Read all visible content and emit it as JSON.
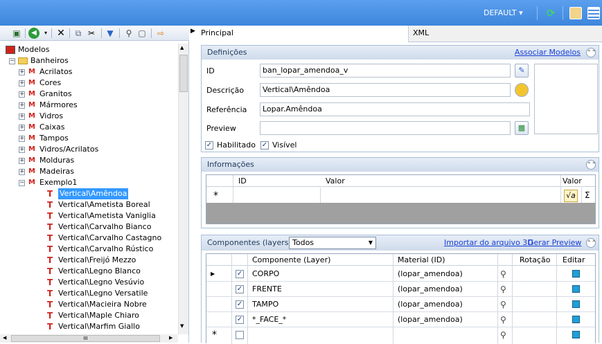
{
  "topbar": {
    "profile_dropdown": "DEFAULT",
    "icons": [
      "refresh-icon",
      "settings-icon",
      "layout-icon"
    ]
  },
  "left_toolbar": {
    "icons": [
      "save-icon",
      "back-icon",
      "delete-icon",
      "copy-icon",
      "cut-icon",
      "move-icon",
      "find-icon",
      "page-icon",
      "export-icon"
    ]
  },
  "tree": {
    "root": "Modelos",
    "category": "Banheiros",
    "groups": [
      "Acrilatos",
      "Cores",
      "Granitos",
      "Mármores",
      "Vidros",
      "Caixas",
      "Tampos",
      "Vidros/Acrilatos",
      "Molduras",
      "Madeiras",
      "Exemplo1"
    ],
    "children": [
      "Vertical\\Amêndoa",
      "Vertical\\Ametista Boreal",
      "Vertical\\Ametista Vaniglia",
      "Vertical\\Carvalho Bianco",
      "Vertical\\Carvalho Castagno",
      "Vertical\\Carvalho Rústico",
      "Vertical\\Freijó Mezzo",
      "Vertical\\Legno Blanco",
      "Vertical\\Legno Vesúvio",
      "Vertical\\Legno Versatile",
      "Vertical\\Macieira Nobre",
      "Vertical\\Maple Chiaro",
      "Vertical\\Marfim Giallo"
    ],
    "hscroll_label": "III"
  },
  "tabs": [
    "Principal",
    "XML"
  ],
  "definicoes": {
    "title": "Definições",
    "link": "Associar Modelos",
    "labels": {
      "id": "ID",
      "descricao": "Descrição",
      "referencia": "Referência",
      "preview": "Preview"
    },
    "values": {
      "id": "ban_lopar_amendoa_v",
      "descricao": "Vertical\\Amêndoa",
      "referencia": "Lopar.Amêndoa",
      "preview": ""
    },
    "habilitado": "Habilitado",
    "visivel": "Visível"
  },
  "informacoes": {
    "title": "Informações",
    "columns": [
      "ID",
      "Valor",
      "Valor"
    ],
    "new_row_marker": "*",
    "sqrt_symbol": "√a",
    "sigma_symbol": "Σ"
  },
  "componentes": {
    "title": "Componentes (layers)",
    "filter": "Todos",
    "link_import": "Importar do arquivo 3D",
    "link_preview": "Gerar Preview",
    "columns": [
      "Componente (Layer)",
      "Material (ID)",
      "Rotação",
      "Editar"
    ],
    "rows": [
      {
        "name": "CORPO",
        "material": "(lopar_amendoa)"
      },
      {
        "name": "FRENTE",
        "material": "(lopar_amendoa)"
      },
      {
        "name": "TAMPO",
        "material": "(lopar_amendoa)"
      },
      {
        "name": "*_FACE_*",
        "material": "(lopar_amendoa)"
      }
    ],
    "new_row_marker": "*"
  }
}
